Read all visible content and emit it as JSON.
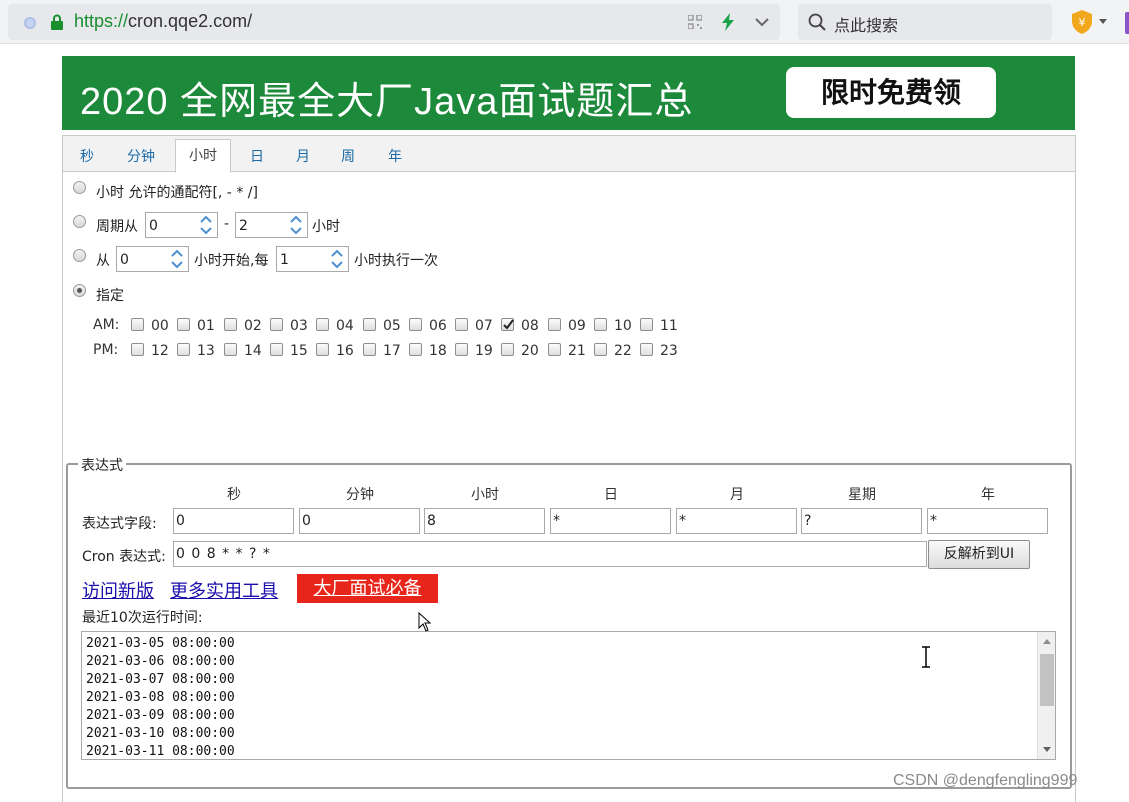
{
  "browser": {
    "url_scheme": "https://",
    "url_rest": "cron.qqe2.com/",
    "search_placeholder": "点此搜索"
  },
  "banner": {
    "title": "2020 全网最全大厂Java面试题汇总",
    "button": "限时免费领"
  },
  "tabs": [
    "秒",
    "分钟",
    "小时",
    "日",
    "月",
    "周",
    "年"
  ],
  "active_tab": "小时",
  "hour_options": {
    "wildcard": "小时 允许的通配符[, - * /]",
    "cycle_prefix": "周期从",
    "cycle_from": "0",
    "cycle_dash": "-",
    "cycle_to": "2",
    "cycle_suffix": "小时",
    "from_prefix": "从",
    "from_start": "0",
    "from_middle": "小时开始,每",
    "from_every": "1",
    "from_suffix": "小时执行一次",
    "specify": "指定",
    "selected": "specify"
  },
  "hour_grid": {
    "am_label": "AM:",
    "pm_label": "PM:",
    "am": [
      "00",
      "01",
      "02",
      "03",
      "04",
      "05",
      "06",
      "07",
      "08",
      "09",
      "10",
      "11"
    ],
    "pm": [
      "12",
      "13",
      "14",
      "15",
      "16",
      "17",
      "18",
      "19",
      "20",
      "21",
      "22",
      "23"
    ],
    "checked": [
      "08"
    ]
  },
  "expression": {
    "legend": "表达式",
    "headers": [
      "秒",
      "分钟",
      "小时",
      "日",
      "月",
      "星期",
      "年"
    ],
    "fields_label": "表达式字段:",
    "fields": [
      "0",
      "0",
      "8",
      "*",
      "*",
      "?",
      "*"
    ],
    "cron_label": "Cron 表达式:",
    "cron_value": "0 0 8 * * ? *",
    "parse_button": "反解析到UI"
  },
  "links": {
    "new_version": "访问新版",
    "more_tools": "更多实用工具",
    "interview": "大厂面试必备"
  },
  "recent": {
    "label": "最近10次运行时间:",
    "times": [
      "2021-03-05 08:00:00",
      "2021-03-06 08:00:00",
      "2021-03-07 08:00:00",
      "2021-03-08 08:00:00",
      "2021-03-09 08:00:00",
      "2021-03-10 08:00:00",
      "2021-03-11 08:00:00"
    ]
  },
  "watermark": "CSDN @dengfengling999",
  "colors": {
    "banner_green": "#1c8a3a",
    "link_blue": "#1a0dab",
    "red_button": "#e8251a",
    "tab_blue": "#1a6aa8"
  },
  "icons": {
    "site": "site-icon",
    "lock": "lock-icon",
    "qr": "qr-code-icon",
    "bolt": "lightning-icon",
    "chevron": "chevron-down-icon",
    "search": "search-icon",
    "extension": "shield-extension-icon"
  }
}
